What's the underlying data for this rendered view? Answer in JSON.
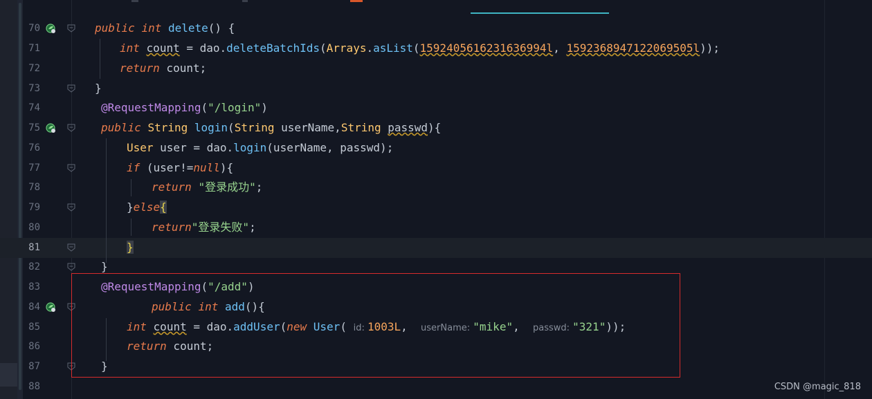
{
  "editor": {
    "gutter_icon": "spring-bean-run-icon",
    "fold_icon": "fold-marker-icon",
    "highlight_color": "#d72c2c",
    "lines": [
      {
        "num": "70",
        "run": true,
        "fold": true,
        "tokens": [
          [
            "kw",
            "public"
          ],
          [
            "plain",
            " "
          ],
          [
            "kw",
            "int"
          ],
          [
            "plain",
            " "
          ],
          [
            "fn",
            "delete"
          ],
          [
            "plain",
            "() {"
          ]
        ]
      },
      {
        "num": "71",
        "tokens": [
          [
            "kw",
            "int"
          ],
          [
            "plain",
            " "
          ],
          [
            "sq",
            "count"
          ],
          [
            "plain",
            " = dao."
          ],
          [
            "fn",
            "deleteBatchIds"
          ],
          [
            "plain",
            "("
          ],
          [
            "ty",
            "Arrays"
          ],
          [
            "plain",
            "."
          ],
          [
            "fn",
            "asList"
          ],
          [
            "plain",
            "("
          ],
          [
            "num sq",
            "1592405616231636994l"
          ],
          [
            "plain",
            ", "
          ],
          [
            "num sq",
            "1592368947122069505l"
          ],
          [
            "plain",
            "));"
          ]
        ]
      },
      {
        "num": "72",
        "tokens": [
          [
            "kw",
            "return"
          ],
          [
            "plain",
            " count;"
          ]
        ]
      },
      {
        "num": "73",
        "fold": true,
        "tokens": [
          [
            "plain",
            "}"
          ]
        ]
      },
      {
        "num": "74",
        "tokens": [
          [
            "ann",
            "@RequestMapping"
          ],
          [
            "plain",
            "("
          ],
          [
            "str",
            "\"/login\""
          ],
          [
            "plain",
            ")"
          ]
        ]
      },
      {
        "num": "75",
        "run": true,
        "fold": true,
        "tokens": [
          [
            "kw",
            "public"
          ],
          [
            "plain",
            " "
          ],
          [
            "ty",
            "String"
          ],
          [
            "plain",
            " "
          ],
          [
            "fn",
            "login"
          ],
          [
            "plain",
            "("
          ],
          [
            "ty",
            "String"
          ],
          [
            "plain",
            " userName,"
          ],
          [
            "ty",
            "String"
          ],
          [
            "plain",
            " "
          ],
          [
            "sq",
            "passwd"
          ],
          [
            "plain",
            "){"
          ]
        ]
      },
      {
        "num": "76",
        "tokens": [
          [
            "ty",
            "User"
          ],
          [
            "plain",
            " user = dao."
          ],
          [
            "fn",
            "login"
          ],
          [
            "plain",
            "(userName, passwd);"
          ]
        ]
      },
      {
        "num": "77",
        "fold": true,
        "tokens": [
          [
            "kw",
            "if"
          ],
          [
            "plain",
            " (user!="
          ],
          [
            "kw",
            "null"
          ],
          [
            "plain",
            "){"
          ]
        ]
      },
      {
        "num": "78",
        "tokens": [
          [
            "kw",
            "return"
          ],
          [
            "plain",
            " "
          ],
          [
            "str",
            "\"登录成功\""
          ],
          [
            "plain",
            ";"
          ]
        ]
      },
      {
        "num": "79",
        "fold": true,
        "tokens": [
          [
            "plain",
            "}"
          ],
          [
            "kw",
            "else"
          ],
          [
            "cursor-box",
            "{"
          ]
        ]
      },
      {
        "num": "80",
        "tokens": [
          [
            "kw",
            "return"
          ],
          [
            "str",
            "\"登录失败\""
          ],
          [
            "plain",
            ";"
          ]
        ]
      },
      {
        "num": "81",
        "fold": true,
        "current": true,
        "tokens": [
          [
            "cursor-box",
            "}"
          ]
        ]
      },
      {
        "num": "82",
        "fold": true,
        "tokens": [
          [
            "plain",
            "}"
          ]
        ]
      },
      {
        "num": "83",
        "tokens": [
          [
            "ann",
            "@RequestMapping"
          ],
          [
            "plain",
            "("
          ],
          [
            "str",
            "\"/add\""
          ],
          [
            "plain",
            ")"
          ]
        ]
      },
      {
        "num": "84",
        "run": true,
        "fold": true,
        "tokens": [
          [
            "kw",
            "public"
          ],
          [
            "plain",
            " "
          ],
          [
            "kw",
            "int"
          ],
          [
            "plain",
            " "
          ],
          [
            "fn",
            "add"
          ],
          [
            "plain",
            "(){"
          ]
        ]
      },
      {
        "num": "85",
        "tokens": [
          [
            "kw",
            "int"
          ],
          [
            "plain",
            " "
          ],
          [
            "sq",
            "count"
          ],
          [
            "plain",
            " = dao."
          ],
          [
            "fn",
            "addUser"
          ],
          [
            "plain",
            "("
          ],
          [
            "kw",
            "new"
          ],
          [
            "plain",
            " "
          ],
          [
            "fn",
            "User"
          ],
          [
            "plain",
            "( "
          ],
          [
            "hint",
            "id: "
          ],
          [
            "num",
            "1003L"
          ],
          [
            "plain",
            ",  "
          ],
          [
            "hint",
            "userName: "
          ],
          [
            "str",
            "\"mike\""
          ],
          [
            "plain",
            ",  "
          ],
          [
            "hint",
            "passwd: "
          ],
          [
            "str",
            "\"321\""
          ],
          [
            "plain",
            "));"
          ]
        ]
      },
      {
        "num": "86",
        "tokens": [
          [
            "kw",
            "return"
          ],
          [
            "plain",
            " count;"
          ]
        ]
      },
      {
        "num": "87",
        "fold": true,
        "tokens": [
          [
            "plain",
            "}"
          ]
        ]
      },
      {
        "num": "88",
        "tokens": []
      }
    ]
  },
  "watermark": "CSDN @magic_818"
}
